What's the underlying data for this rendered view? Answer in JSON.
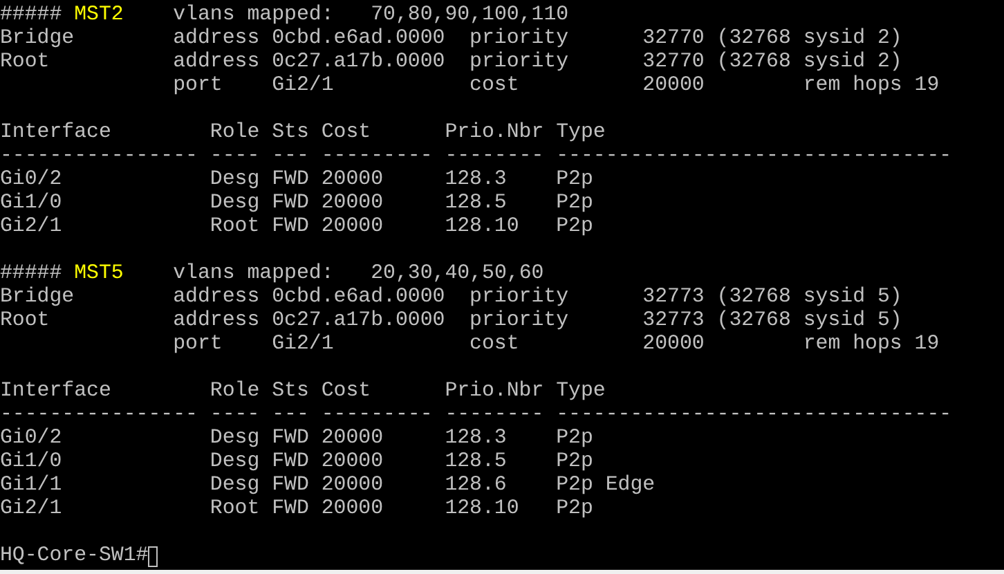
{
  "lines": [
    {
      "kind": "text",
      "segments": [
        {
          "text": "##### ",
          "highlight": false
        },
        {
          "text": "MST2",
          "highlight": true
        },
        {
          "text": "    vlans mapped:   70,80,90,100,110",
          "highlight": false
        }
      ]
    },
    {
      "kind": "text",
      "segments": [
        {
          "text": "Bridge        address 0cbd.e6ad.0000  priority      32770 (32768 sysid 2)",
          "highlight": false
        }
      ]
    },
    {
      "kind": "text",
      "segments": [
        {
          "text": "Root          address 0c27.a17b.0000  priority      32770 (32768 sysid 2)",
          "highlight": false
        }
      ]
    },
    {
      "kind": "text",
      "segments": [
        {
          "text": "              port    Gi2/1           cost          20000        rem hops 19",
          "highlight": false
        }
      ]
    },
    {
      "kind": "blank"
    },
    {
      "kind": "text",
      "segments": [
        {
          "text": "Interface        Role Sts Cost      Prio.Nbr Type",
          "highlight": false
        }
      ]
    },
    {
      "kind": "text",
      "segments": [
        {
          "text": "---------------- ---- --- --------- -------- --------------------------------",
          "highlight": false
        }
      ]
    },
    {
      "kind": "text",
      "segments": [
        {
          "text": "Gi0/2            Desg FWD 20000     128.3    P2p",
          "highlight": false
        }
      ]
    },
    {
      "kind": "text",
      "segments": [
        {
          "text": "Gi1/0            Desg FWD 20000     128.5    P2p",
          "highlight": false
        }
      ]
    },
    {
      "kind": "text",
      "segments": [
        {
          "text": "Gi2/1            Root FWD 20000     128.10   P2p",
          "highlight": false
        }
      ]
    },
    {
      "kind": "blank"
    },
    {
      "kind": "text",
      "segments": [
        {
          "text": "##### ",
          "highlight": false
        },
        {
          "text": "MST5",
          "highlight": true
        },
        {
          "text": "    vlans mapped:   20,30,40,50,60",
          "highlight": false
        }
      ]
    },
    {
      "kind": "text",
      "segments": [
        {
          "text": "Bridge        address 0cbd.e6ad.0000  priority      32773 (32768 sysid 5)",
          "highlight": false
        }
      ]
    },
    {
      "kind": "text",
      "segments": [
        {
          "text": "Root          address 0c27.a17b.0000  priority      32773 (32768 sysid 5)",
          "highlight": false
        }
      ]
    },
    {
      "kind": "text",
      "segments": [
        {
          "text": "              port    Gi2/1           cost          20000        rem hops 19",
          "highlight": false
        }
      ]
    },
    {
      "kind": "blank"
    },
    {
      "kind": "text",
      "segments": [
        {
          "text": "Interface        Role Sts Cost      Prio.Nbr Type",
          "highlight": false
        }
      ]
    },
    {
      "kind": "text",
      "segments": [
        {
          "text": "---------------- ---- --- --------- -------- --------------------------------",
          "highlight": false
        }
      ]
    },
    {
      "kind": "text",
      "segments": [
        {
          "text": "Gi0/2            Desg FWD 20000     128.3    P2p",
          "highlight": false
        }
      ]
    },
    {
      "kind": "text",
      "segments": [
        {
          "text": "Gi1/0            Desg FWD 20000     128.5    P2p",
          "highlight": false
        }
      ]
    },
    {
      "kind": "text",
      "segments": [
        {
          "text": "Gi1/1            Desg FWD 20000     128.6    P2p Edge",
          "highlight": false
        }
      ]
    },
    {
      "kind": "text",
      "segments": [
        {
          "text": "Gi2/1            Root FWD 20000     128.10   P2p",
          "highlight": false
        }
      ]
    },
    {
      "kind": "blank"
    },
    {
      "kind": "prompt",
      "segments": [
        {
          "text": "HQ-Core-SW1#",
          "highlight": false
        }
      ],
      "cursor": true
    }
  ]
}
